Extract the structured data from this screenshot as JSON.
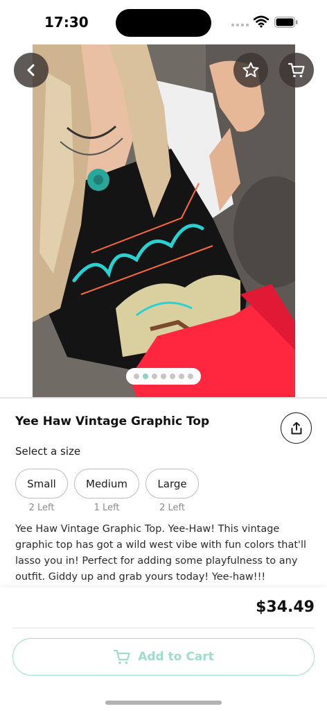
{
  "status_bar": {
    "time": "17:30"
  },
  "colors": {
    "accent": "#9fdccd",
    "pager_active": "#8ed2c3",
    "nav_button_bg": "#3c3432"
  },
  "icons": {
    "back": "chevron-left-icon",
    "favorite": "star-icon",
    "cart": "cart-icon",
    "share": "share-icon"
  },
  "gallery": {
    "image_count": 7,
    "active_index": 1
  },
  "product": {
    "title": "Yee Haw Vintage Graphic Top",
    "price": "$34.49",
    "description": "Yee Haw Vintage Graphic Top. Yee-Haw! This vintage graphic top has got a wild west vibe with fun colors that'll lasso you in! Perfect for adding some playfulness to any outfit. Giddy up and grab yours today! Yee-haw!!!"
  },
  "sizes": {
    "prompt": "Select a size",
    "options": [
      {
        "label": "Small",
        "stock": "2 Left"
      },
      {
        "label": "Medium",
        "stock": "1 Left"
      },
      {
        "label": "Large",
        "stock": "2 Left"
      }
    ]
  },
  "actions": {
    "add_to_cart": "Add to Cart"
  }
}
